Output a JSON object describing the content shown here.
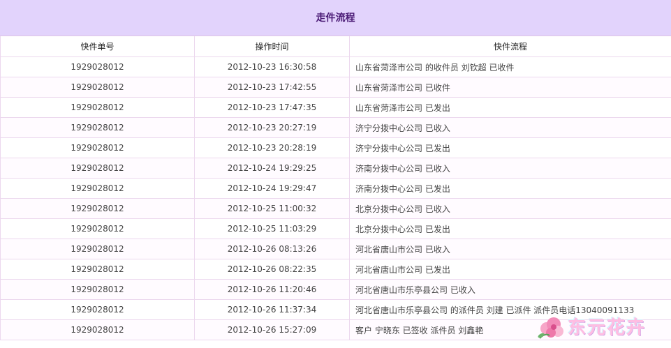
{
  "title": "走件流程",
  "columns": [
    "快件单号",
    "操作时间",
    "快件流程"
  ],
  "rows": [
    {
      "no": "1929028012",
      "time": "2012-10-23 16:30:58",
      "flow": "山东省菏泽市公司 的收件员 刘钦超 已收件"
    },
    {
      "no": "1929028012",
      "time": "2012-10-23 17:42:55",
      "flow": "山东省菏泽市公司 已收件"
    },
    {
      "no": "1929028012",
      "time": "2012-10-23 17:47:35",
      "flow": "山东省菏泽市公司 已发出"
    },
    {
      "no": "1929028012",
      "time": "2012-10-23 20:27:19",
      "flow": "济宁分拨中心公司 已收入"
    },
    {
      "no": "1929028012",
      "time": "2012-10-23 20:28:19",
      "flow": "济宁分拨中心公司 已发出"
    },
    {
      "no": "1929028012",
      "time": "2012-10-24 19:29:25",
      "flow": "济南分拨中心公司 已收入"
    },
    {
      "no": "1929028012",
      "time": "2012-10-24 19:29:47",
      "flow": "济南分拨中心公司 已发出"
    },
    {
      "no": "1929028012",
      "time": "2012-10-25 11:00:32",
      "flow": "北京分拨中心公司 已收入"
    },
    {
      "no": "1929028012",
      "time": "2012-10-25 11:03:29",
      "flow": "北京分拨中心公司 已发出"
    },
    {
      "no": "1929028012",
      "time": "2012-10-26 08:13:26",
      "flow": "河北省唐山市公司 已收入"
    },
    {
      "no": "1929028012",
      "time": "2012-10-26 08:22:35",
      "flow": "河北省唐山市公司 已发出"
    },
    {
      "no": "1929028012",
      "time": "2012-10-26 11:20:46",
      "flow": "河北省唐山市乐亭县公司 已收入"
    },
    {
      "no": "1929028012",
      "time": "2012-10-26 11:37:34",
      "flow": "河北省唐山市乐亭县公司 的派件员 刘建 已派件 派件员电话13040091133"
    },
    {
      "no": "1929028012",
      "time": "2012-10-26 15:27:09",
      "flow": "客户 宁晓东 已签收 派件员 刘鑫艳"
    }
  ],
  "watermark": {
    "text": "东元花卉",
    "icon": "flower-icon"
  },
  "colors": {
    "header_bg": "#e2d3fc",
    "title_text": "#4a1a75",
    "border": "#ecd8ee"
  }
}
